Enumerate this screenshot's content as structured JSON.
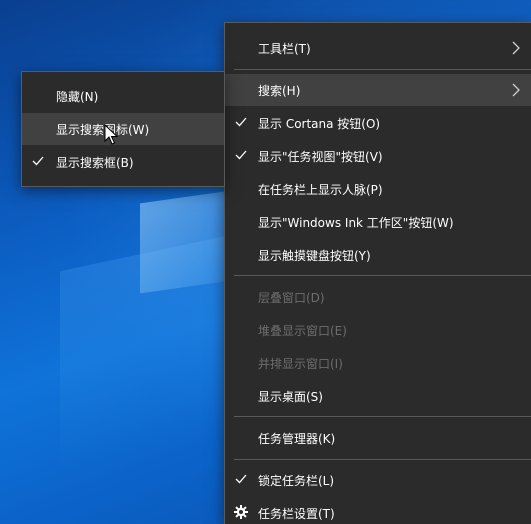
{
  "submenu": {
    "items": [
      {
        "label": "隐藏(N)",
        "checked": false
      },
      {
        "label": "显示搜索图标(W)",
        "checked": false,
        "hovered": true
      },
      {
        "label": "显示搜索框(B)",
        "checked": true
      }
    ]
  },
  "menu": {
    "toolbar_label": "工具栏(T)",
    "search_label": "搜索(H)",
    "show_cortana_label": "显示 Cortana 按钮(O)",
    "show_task_view_label": "显示\"任务视图\"按钮(V)",
    "show_people_label": "在任务栏上显示人脉(P)",
    "show_ink_label": "显示\"Windows Ink 工作区\"按钮(W)",
    "show_touch_keyboard_label": "显示触摸键盘按钮(Y)",
    "cascade_label": "层叠窗口(D)",
    "stack_label": "堆叠显示窗口(E)",
    "side_by_side_label": "并排显示窗口(I)",
    "show_desktop_label": "显示桌面(S)",
    "task_manager_label": "任务管理器(K)",
    "lock_taskbar_label": "锁定任务栏(L)",
    "taskbar_settings_label": "任务栏设置(T)"
  },
  "colors": {
    "menu_bg": "#2b2b2b",
    "hover_bg": "#414141",
    "disabled_text": "#6d6d6d",
    "separator": "#5a5a5a"
  }
}
